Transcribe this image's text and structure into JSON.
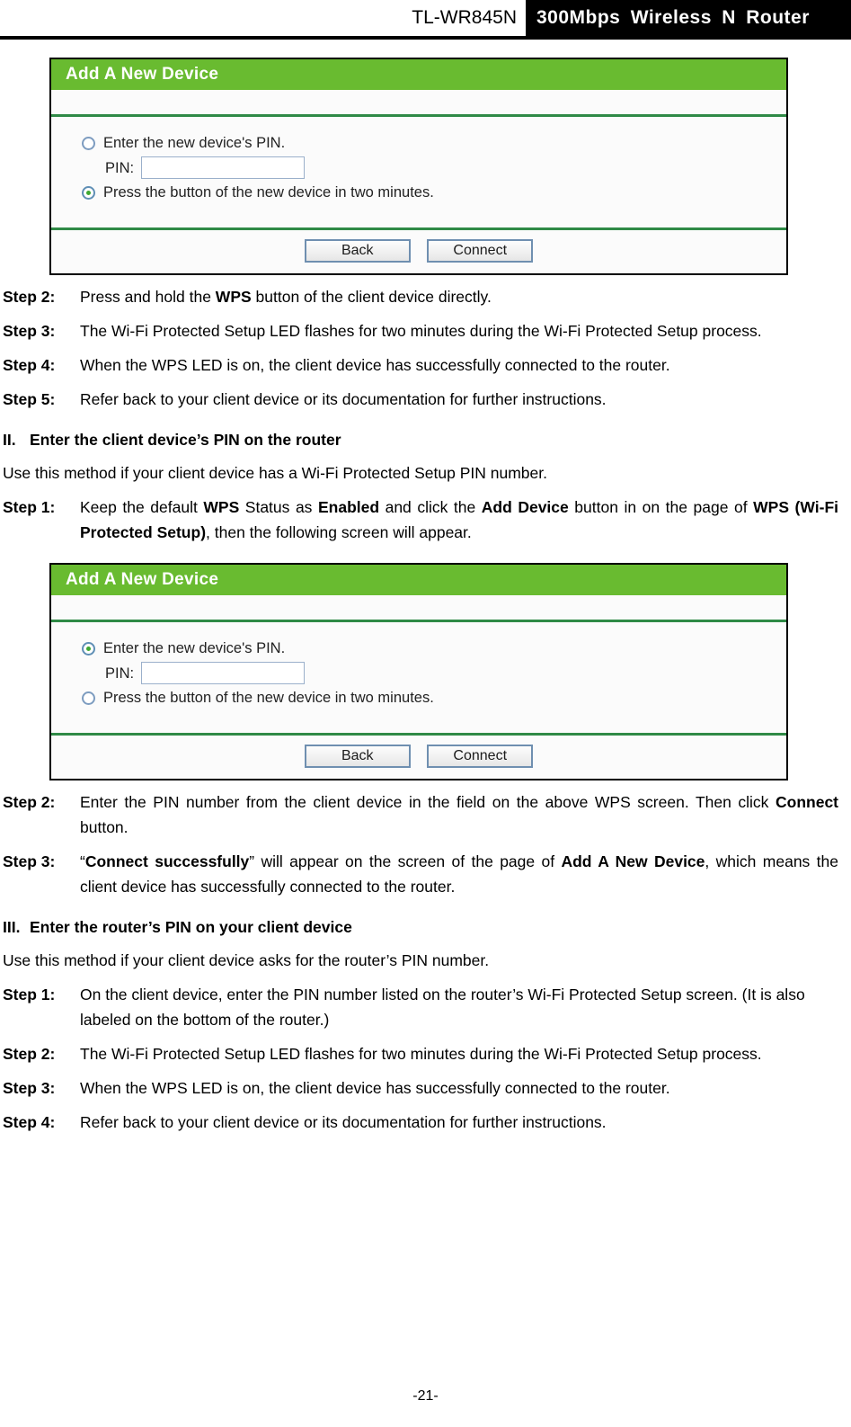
{
  "header": {
    "model": "TL-WR845N",
    "product": "300Mbps  Wireless  N  Router"
  },
  "panel_one": {
    "title": "Add A New Device",
    "option_pin_label": "Enter the new device's PIN.",
    "option_pin_selected": false,
    "pin_caption": "PIN:",
    "pin_value": "",
    "option_button_label": "Press the button of the new device in two minutes.",
    "option_button_selected": true,
    "back_label": "Back",
    "connect_label": "Connect"
  },
  "panel_two": {
    "title": "Add A New Device",
    "option_pin_label": "Enter the new device's PIN.",
    "option_pin_selected": true,
    "pin_caption": "PIN:",
    "pin_value": "",
    "option_button_label": "Press the button of the new device in two minutes.",
    "option_button_selected": false,
    "back_label": "Back",
    "connect_label": "Connect"
  },
  "steps_first_group": [
    {
      "label": "Step 2:",
      "text_prefix": "Press and hold the ",
      "bold1": "WPS",
      "text_suffix": " button of the client device directly."
    },
    {
      "label": "Step 3:",
      "text_prefix": "The Wi-Fi Protected Setup LED flashes for two minutes during the Wi-Fi Protected Setup process.",
      "bold1": "",
      "text_suffix": ""
    },
    {
      "label": "Step 4:",
      "text_prefix": "When the WPS LED is on, the client device has successfully connected to the router.",
      "bold1": "",
      "text_suffix": ""
    },
    {
      "label": "Step 5:",
      "text_prefix": "Refer back to your client device or its documentation for further instructions.",
      "bold1": "",
      "text_suffix": ""
    }
  ],
  "section_two": {
    "number": "II.",
    "heading": "Enter the client device’s PIN on the router",
    "intro": "Use this method if your client device has a Wi-Fi Protected Setup PIN number.",
    "step1": {
      "label": "Step 1:",
      "t1": "Keep the default ",
      "b1": "WPS",
      "t2": " Status as ",
      "b2": "Enabled",
      "t3": " and click the ",
      "b3": "Add Device",
      "t4": " button in on the page of ",
      "b4": "WPS (Wi-Fi Protected Setup)",
      "t5": ", then the following screen will appear."
    }
  },
  "steps_second_group": {
    "step2": {
      "label": "Step 2:",
      "t1": "Enter the PIN number from the client device in the field on the above WPS screen. Then click ",
      "b1": "Connect",
      "t2": " button."
    },
    "step3": {
      "label": "Step 3:",
      "t1": "“",
      "b1": "Connect successfully",
      "t2": "” will appear on the screen of the page of ",
      "b2": "Add A New Device",
      "t3": ", which means the client device has successfully connected to the router."
    }
  },
  "section_three": {
    "number": "III.",
    "heading": "Enter the router’s PIN on your client device",
    "intro": "Use this method if your client device asks for the router’s PIN number.",
    "steps": [
      {
        "label": "Step 1:",
        "text": "On the client device, enter the PIN number listed on the router’s Wi-Fi Protected Setup screen. (It is also labeled on the bottom of the router.)"
      },
      {
        "label": "Step 2:",
        "text": "The Wi-Fi Protected Setup LED flashes for two minutes during the Wi-Fi Protected Setup process."
      },
      {
        "label": "Step 3:",
        "text": "When the WPS LED is on, the client device has successfully connected to the router."
      },
      {
        "label": "Step 4:",
        "text": "Refer back to your client device or its documentation for further instructions."
      }
    ]
  },
  "footer": {
    "page_number": "-21-"
  },
  "colors": {
    "panel_header_green": "#69bb30",
    "separator_green": "#2f8a46",
    "radio_dot_green": "#3ea832",
    "header_black": "#000000"
  }
}
